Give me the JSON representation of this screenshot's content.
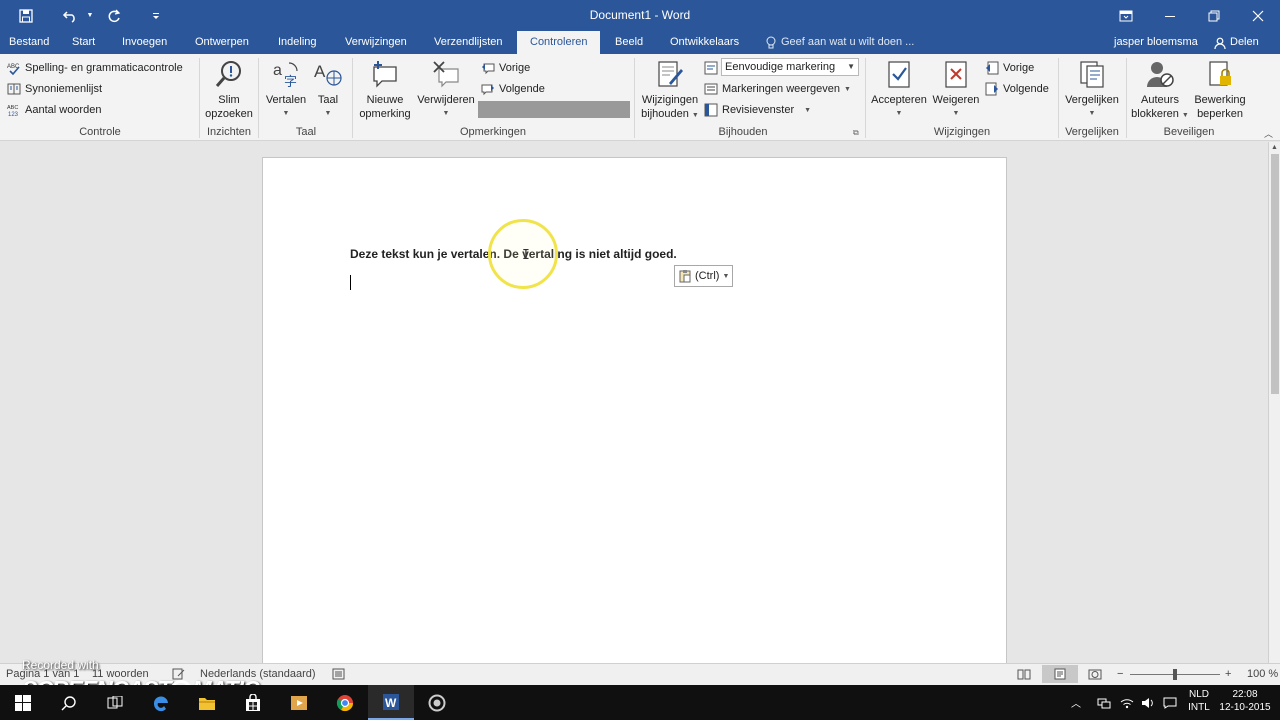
{
  "window": {
    "title": "Document1 - Word"
  },
  "tabs": [
    {
      "label": "Bestand"
    },
    {
      "label": "Start"
    },
    {
      "label": "Invoegen"
    },
    {
      "label": "Ontwerpen"
    },
    {
      "label": "Indeling"
    },
    {
      "label": "Verwijzingen"
    },
    {
      "label": "Verzendlijsten"
    },
    {
      "label": "Controleren"
    },
    {
      "label": "Beeld"
    },
    {
      "label": "Ontwikkelaars"
    }
  ],
  "active_tab": "Controleren",
  "tellme": {
    "placeholder": "Geef aan wat u wilt doen ..."
  },
  "user": {
    "name": "jasper bloemsma",
    "share_label": "Delen"
  },
  "ribbon": {
    "controle": {
      "label": "Controle",
      "spelling": "Spelling- en grammaticacontrole",
      "synonyms": "Synoniemenlijst",
      "wordcount": "Aantal woorden"
    },
    "inzichten": {
      "label": "Inzichten",
      "smart_lookup_line1": "Slim",
      "smart_lookup_line2": "opzoeken"
    },
    "taal": {
      "label": "Taal",
      "translate": "Vertalen",
      "language": "Taal"
    },
    "opmerkingen": {
      "label": "Opmerkingen",
      "new_line1": "Nieuwe",
      "new_line2": "opmerking",
      "delete": "Verwijderen",
      "previous": "Vorige",
      "next": "Volgende"
    },
    "bijhouden": {
      "label": "Bijhouden",
      "track_line1": "Wijzigingen",
      "track_line2": "bijhouden",
      "markup_mode": "Eenvoudige markering",
      "show_markup": "Markeringen weergeven",
      "reviewing_pane": "Revisievenster"
    },
    "wijzigingen": {
      "label": "Wijzigingen",
      "accept": "Accepteren",
      "reject": "Weigeren",
      "previous": "Vorige",
      "next": "Volgende"
    },
    "vergelijken": {
      "label": "Vergelijken",
      "compare": "Vergelijken"
    },
    "beveiligen": {
      "label": "Beveiligen",
      "block_line1": "Auteurs",
      "block_line2": "blokkeren",
      "restrict_line1": "Bewerking",
      "restrict_line2": "beperken"
    }
  },
  "document": {
    "text": "Deze tekst kun je vertalen. De vertaling is niet altijd goed.",
    "paste_options": "(Ctrl)"
  },
  "statusbar": {
    "page": "Pagina 1 van 1",
    "words": "11 woorden",
    "language": "Nederlands (standaard)",
    "zoom": "100 %"
  },
  "watermark": {
    "line1": "Recorded with",
    "brand": "SCREENCAST",
    "brand_o": "O",
    "brand_end": "MATIC"
  },
  "taskbar": {
    "lang_line1": "NLD",
    "lang_line2": "INTL",
    "time": "22:08",
    "date": "12-10-2015"
  },
  "colors": {
    "word_blue": "#2b579a",
    "ribbon_bg": "#f3f3f3",
    "highlight_ring": "#f1e34a"
  }
}
